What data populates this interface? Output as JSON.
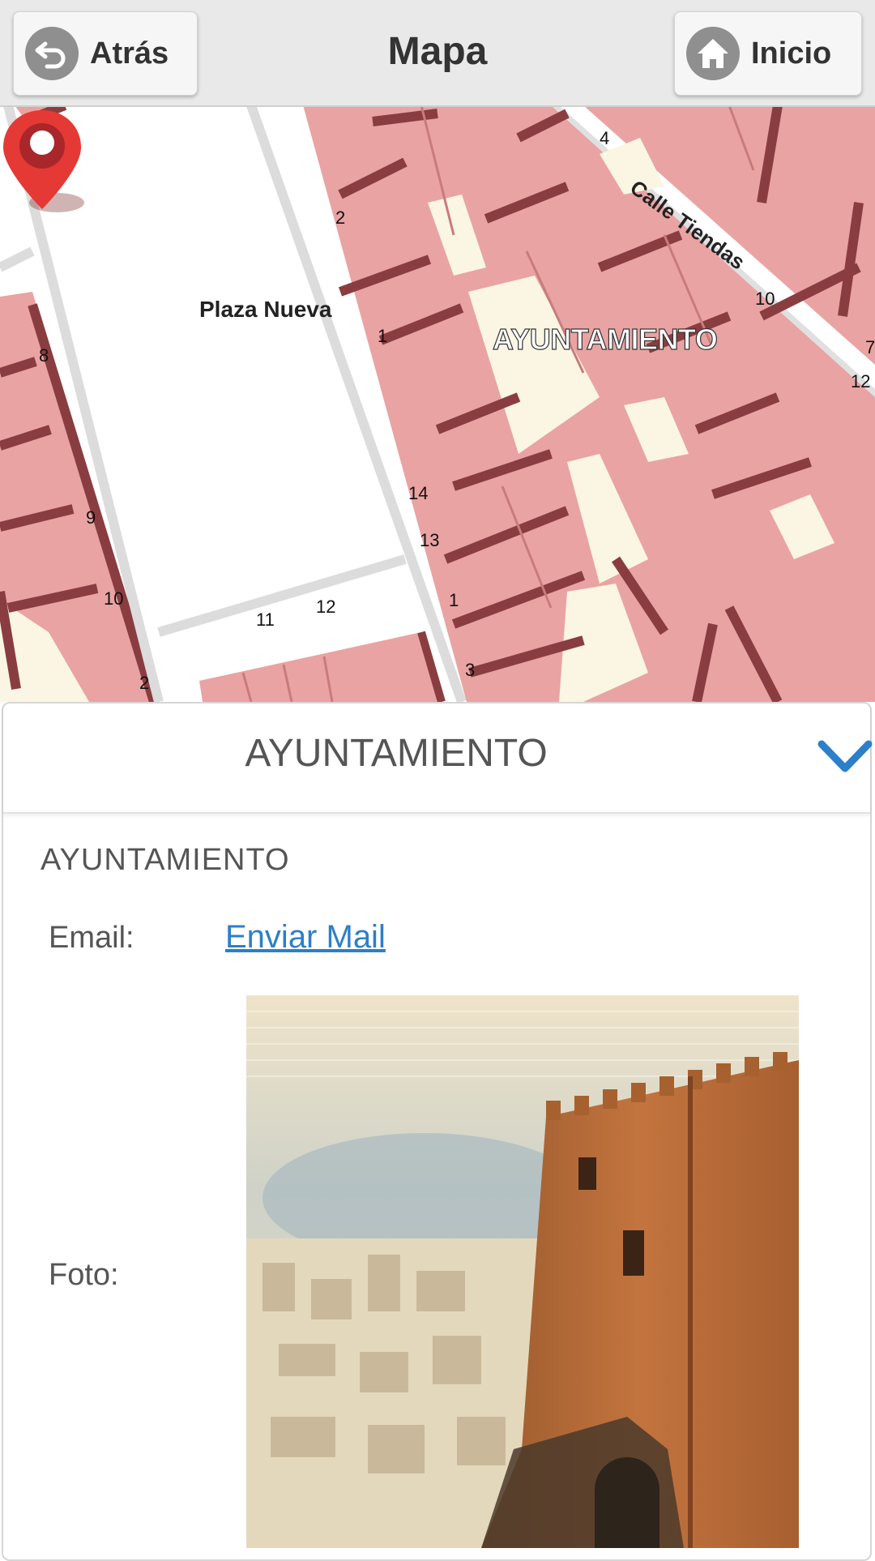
{
  "header": {
    "title": "Mapa",
    "back_label": "Atrás",
    "home_label": "Inicio"
  },
  "map": {
    "place_label": "Plaza Nueva",
    "poi_label": "AYUNTAMIENTO",
    "street_label": "Calle Tiendas",
    "house_numbers": [
      "4",
      "2",
      "1",
      "8",
      "14",
      "13",
      "9",
      "10",
      "11",
      "12",
      "1",
      "3",
      "2",
      "10",
      "12",
      "7"
    ],
    "colors": {
      "building": "#e9a3a3",
      "building_edge": "#8a3d40",
      "courtyard": "#fbf6e3",
      "street": "#ffffff",
      "pin": "#e53935"
    }
  },
  "panel": {
    "title": "AYUNTAMIENTO",
    "subtitle": "AYUNTAMIENTO",
    "email_label": "Email:",
    "email_link": "Enviar Mail",
    "photo_label": "Foto:",
    "accent": "#2c7fc9"
  }
}
